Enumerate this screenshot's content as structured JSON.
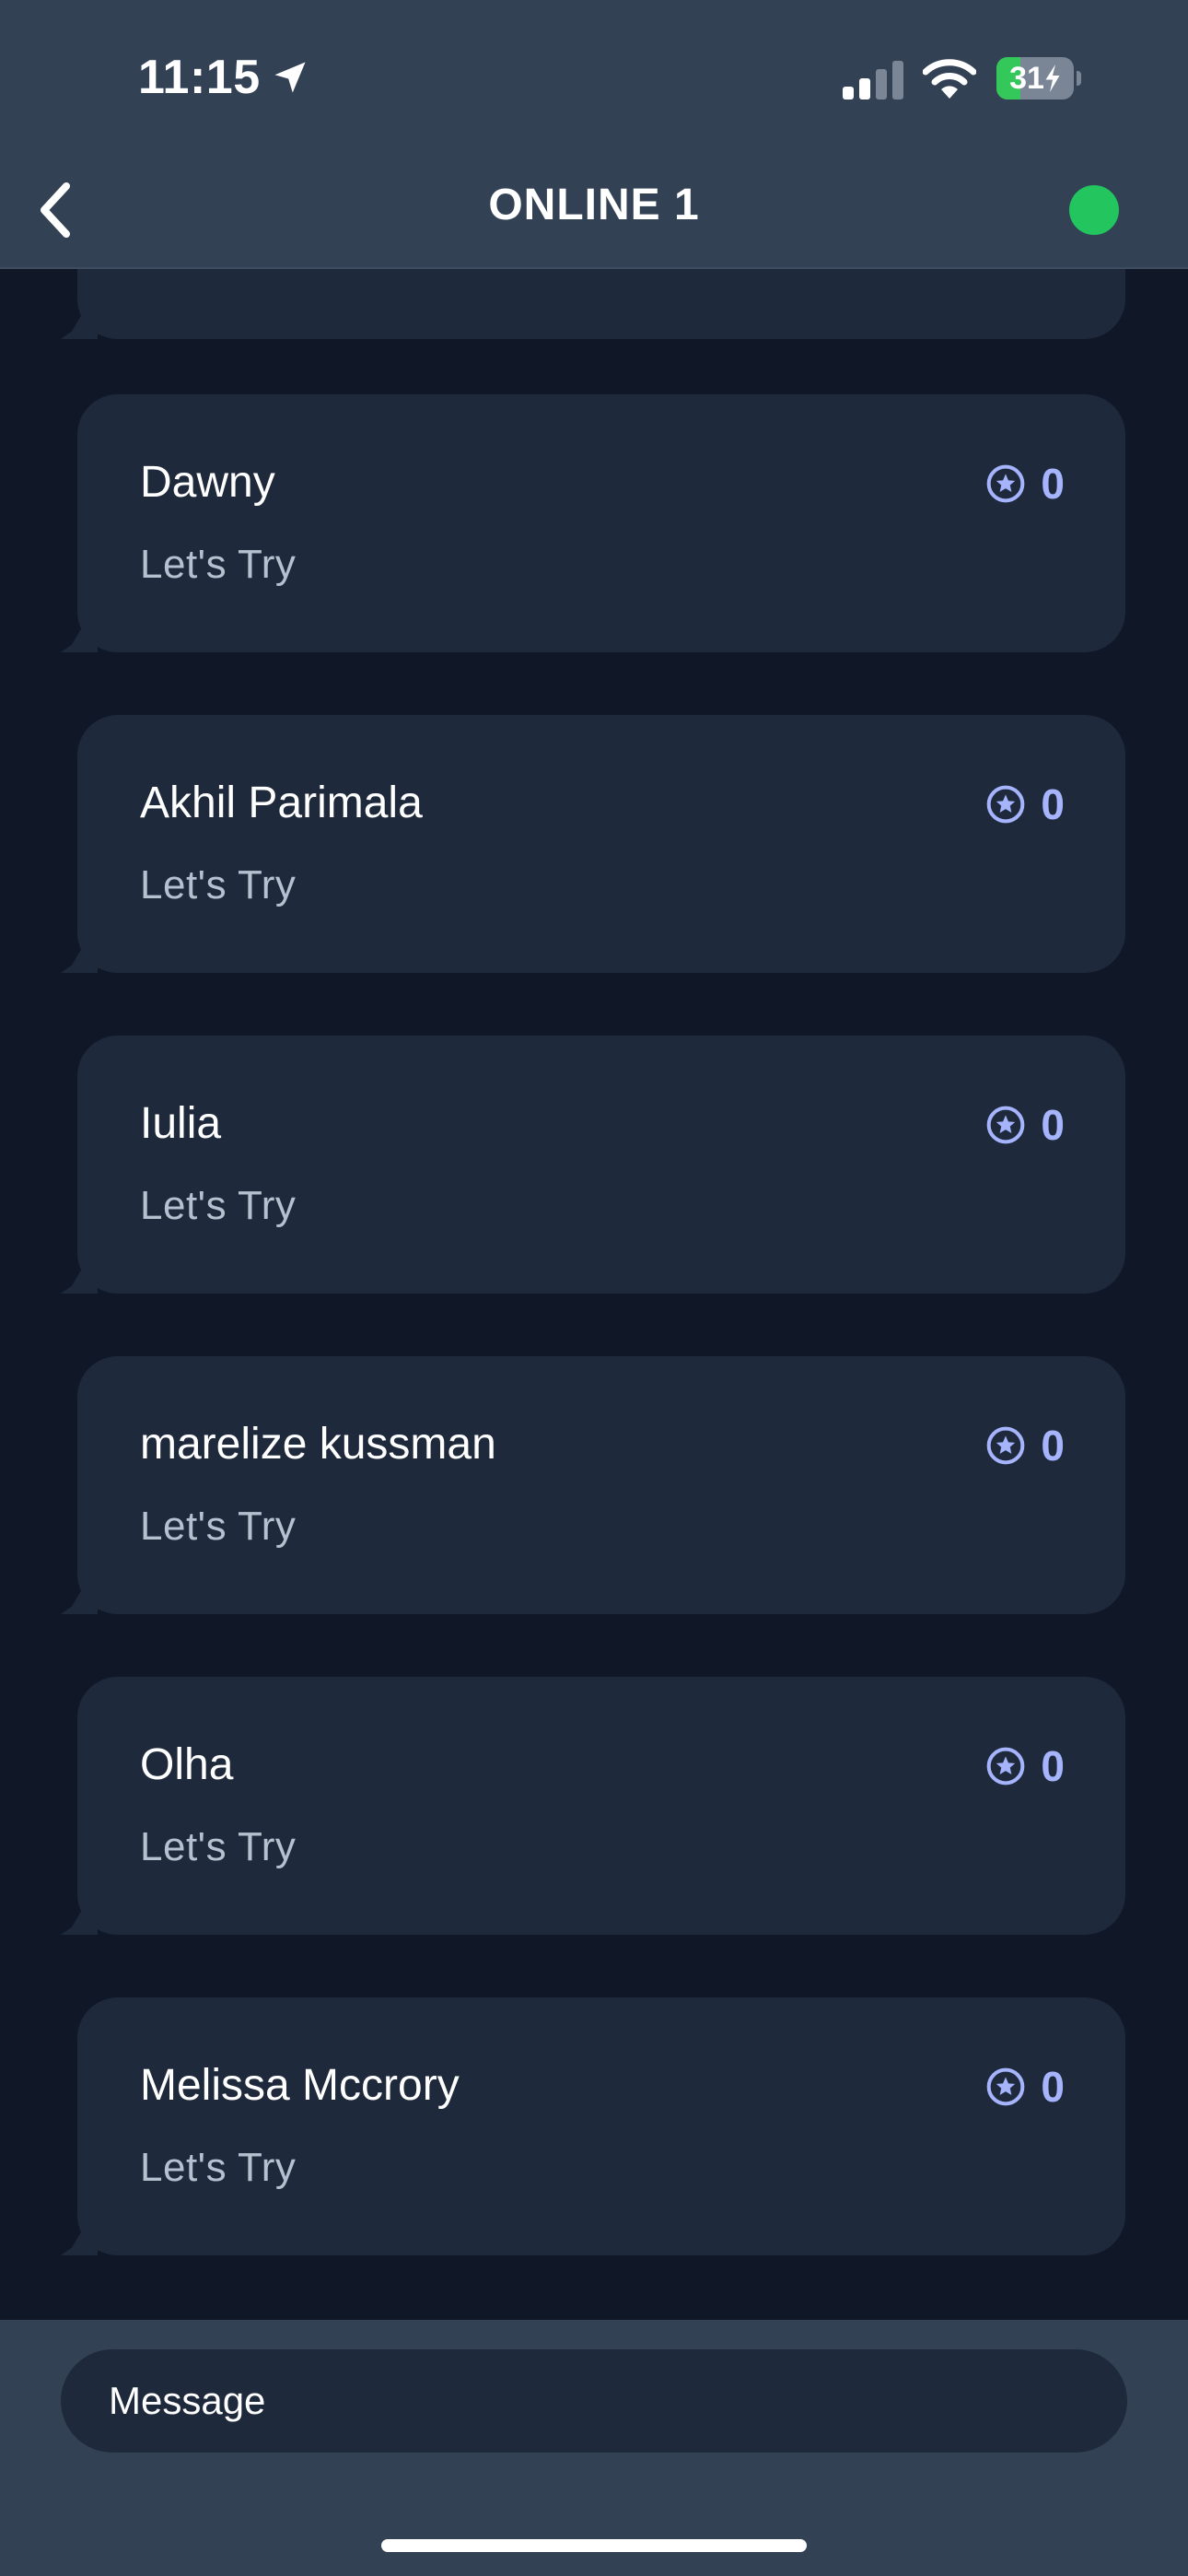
{
  "status_bar": {
    "time": "11:15",
    "battery_level": "31",
    "battery_fraction": 0.31,
    "location_icon": "location-arrow-icon",
    "signal_icon": "cellular-signal-icon",
    "wifi_icon": "wifi-icon",
    "battery_icon": "battery-charging-icon"
  },
  "header": {
    "title": "ONLINE 1",
    "back_icon": "chevron-left-icon",
    "status_color": "#22c55e"
  },
  "colors": {
    "panel": "#334155",
    "background": "#101828",
    "bubble": "#1e293b",
    "score_accent": "#a5b4fc"
  },
  "messages": [
    {
      "name": "",
      "text": "",
      "score": ""
    },
    {
      "name": "Dawny",
      "text": "Let's Try",
      "score": "0"
    },
    {
      "name": "Akhil Parimala",
      "text": "Let's Try",
      "score": "0"
    },
    {
      "name": "Iulia",
      "text": "Let's Try",
      "score": "0"
    },
    {
      "name": "marelize kussman",
      "text": "Let's Try",
      "score": "0"
    },
    {
      "name": "Olha",
      "text": "Let's Try",
      "score": "0"
    },
    {
      "name": "Melissa Mccrory",
      "text": "Let's Try",
      "score": "0"
    }
  ],
  "score_icon": "star-badge-icon",
  "composer": {
    "placeholder": "Message"
  }
}
